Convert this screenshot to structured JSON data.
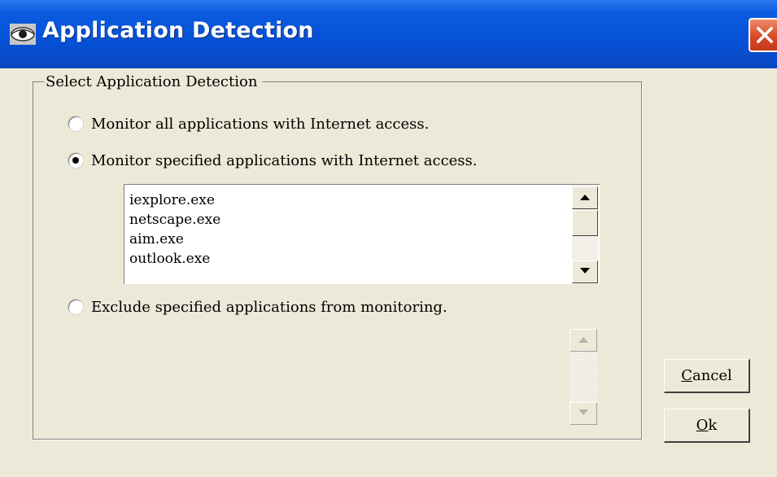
{
  "window": {
    "title": "Application Detection",
    "icon": "app-eye-icon",
    "close_icon": "close-icon"
  },
  "group": {
    "legend": "Select Application Detection"
  },
  "options": [
    {
      "label": "Monitor all applications with Internet access.",
      "selected": false
    },
    {
      "label": "Monitor specified applications with Internet access.",
      "selected": true
    },
    {
      "label": "Exclude specified applications from monitoring.",
      "selected": false
    }
  ],
  "monitor_list": {
    "items": [
      "iexplore.exe",
      "netscape.exe",
      "aim.exe",
      "outlook.exe"
    ]
  },
  "buttons": {
    "cancel_mnemonic": "C",
    "cancel_rest": "ancel",
    "ok_mnemonic": "O",
    "ok_rest": "k"
  },
  "colors": {
    "titlebar": "#0551d6",
    "dialog_bg": "#ece9d8",
    "close_button": "#d94b27"
  }
}
